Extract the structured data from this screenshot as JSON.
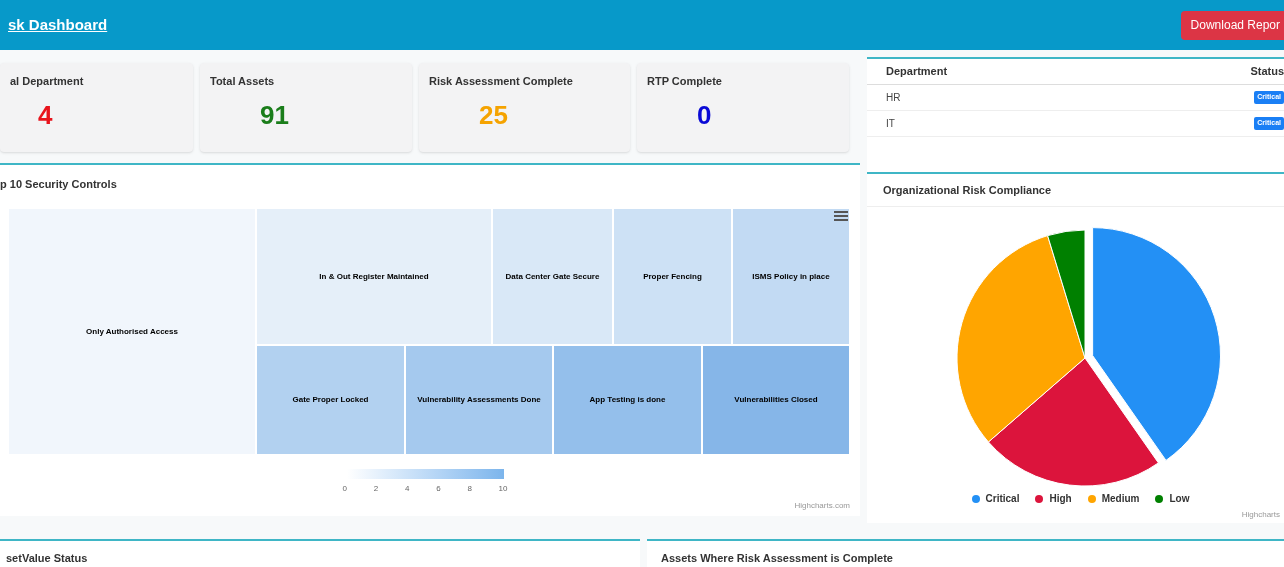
{
  "header": {
    "title": "sk Dashboard",
    "button": "Download Repor"
  },
  "stats": [
    {
      "label": "al Department",
      "value": "4",
      "color": "#e8141c"
    },
    {
      "label": "Total Assets",
      "value": "91",
      "color": "#1a7d1a"
    },
    {
      "label": "Risk Assessment Complete",
      "value": "25",
      "color": "#f5a300"
    },
    {
      "label": "RTP Complete",
      "value": "0",
      "color": "#0a0ad6"
    }
  ],
  "department_table": {
    "columns": [
      "Department",
      "Status"
    ],
    "rows": [
      {
        "department": "HR",
        "status": "Critical"
      },
      {
        "department": "IT",
        "status": "Critical"
      }
    ]
  },
  "treemap_panel": {
    "title": "p 10 Security Controls",
    "cells": [
      {
        "label": "Only Authorised Access",
        "color": "#f1f6fc"
      },
      {
        "label": "In & Out Register Maintained",
        "color": "#e5eff9"
      },
      {
        "label": "Data Center Gate Secure",
        "color": "#d9e8f7"
      },
      {
        "label": "Proper Fencing",
        "color": "#cde1f5"
      },
      {
        "label": "ISMS Policy in place",
        "color": "#c2daf3"
      },
      {
        "label": "Gate Proper Locked",
        "color": "#b2d1f0"
      },
      {
        "label": "Vulnerability Assessments Done",
        "color": "#a5c9ee"
      },
      {
        "label": "App Testing is done",
        "color": "#94bfeb"
      },
      {
        "label": "Vulnerabilities Closed",
        "color": "#86b6e8"
      }
    ],
    "scale_ticks": [
      "0",
      "2",
      "4",
      "6",
      "8",
      "10"
    ],
    "credit": "Highcharts.com"
  },
  "pie_panel": {
    "title": "Organizational Risk Compliance",
    "legend": [
      {
        "label": "Critical",
        "color": "#2390f5"
      },
      {
        "label": "High",
        "color": "#dc143c"
      },
      {
        "label": "Medium",
        "color": "#ffa500"
      },
      {
        "label": "Low",
        "color": "#008000"
      }
    ],
    "credit": "Highcharts"
  },
  "bottom_panels": [
    {
      "title": "setValue Status"
    },
    {
      "title": "Assets Where Risk Assessment is Complete"
    }
  ]
}
